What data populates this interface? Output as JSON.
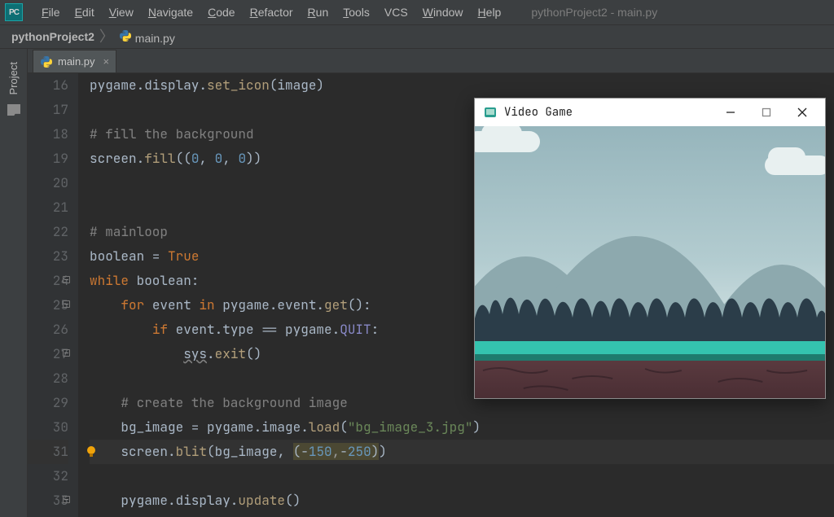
{
  "menubar": {
    "items": [
      "File",
      "Edit",
      "View",
      "Navigate",
      "Code",
      "Refactor",
      "Run",
      "Tools",
      "VCS",
      "Window",
      "Help"
    ],
    "window_title": "pythonProject2 - main.py"
  },
  "breadcrumb": {
    "project": "pythonProject2",
    "file": "main.py"
  },
  "sidebar": {
    "project_label": "Project"
  },
  "editor_tab": {
    "file": "main.py"
  },
  "gutter": {
    "start": 16,
    "count": 18,
    "bulb_line": 31
  },
  "code_lines": [
    {
      "n": 16,
      "segs": [
        {
          "t": "pygame.display."
        },
        {
          "t": "set_icon",
          "c": "tok-func"
        },
        {
          "t": "(image)"
        }
      ]
    },
    {
      "n": 17,
      "segs": []
    },
    {
      "n": 18,
      "segs": [
        {
          "t": "# fill the background",
          "c": "tok-comm"
        }
      ]
    },
    {
      "n": 19,
      "segs": [
        {
          "t": "screen."
        },
        {
          "t": "fill",
          "c": "tok-func"
        },
        {
          "t": "(("
        },
        {
          "t": "0",
          "c": "tok-num"
        },
        {
          "t": ", "
        },
        {
          "t": "0",
          "c": "tok-num"
        },
        {
          "t": ", "
        },
        {
          "t": "0",
          "c": "tok-num"
        },
        {
          "t": "))"
        }
      ]
    },
    {
      "n": 20,
      "segs": []
    },
    {
      "n": 21,
      "segs": []
    },
    {
      "n": 22,
      "segs": [
        {
          "t": "# mainloop",
          "c": "tok-comm"
        }
      ]
    },
    {
      "n": 23,
      "segs": [
        {
          "t": "boolean = "
        },
        {
          "t": "True",
          "c": "tok-key"
        }
      ]
    },
    {
      "n": 24,
      "segs": [
        {
          "t": "while ",
          "c": "tok-key"
        },
        {
          "t": "boolean:"
        }
      ],
      "fold": "minus"
    },
    {
      "n": 25,
      "segs": [
        {
          "t": "    "
        },
        {
          "t": "for ",
          "c": "tok-key"
        },
        {
          "t": "event "
        },
        {
          "t": "in ",
          "c": "tok-key"
        },
        {
          "t": "pygame.event."
        },
        {
          "t": "get",
          "c": "tok-func"
        },
        {
          "t": "():"
        }
      ],
      "fold": "minus"
    },
    {
      "n": 26,
      "segs": [
        {
          "t": "        "
        },
        {
          "t": "if ",
          "c": "tok-key"
        },
        {
          "t": "event.type == pygame."
        },
        {
          "t": "QUIT",
          "c": "tok-builtin"
        },
        {
          "t": ":"
        }
      ]
    },
    {
      "n": 27,
      "segs": [
        {
          "t": "            "
        },
        {
          "t": "sys",
          "c": "tok-wavy"
        },
        {
          "t": "."
        },
        {
          "t": "exit",
          "c": "tok-func"
        },
        {
          "t": "()"
        }
      ],
      "fold": "minus"
    },
    {
      "n": 28,
      "segs": []
    },
    {
      "n": 29,
      "segs": [
        {
          "t": "    "
        },
        {
          "t": "# create the background image",
          "c": "tok-comm"
        }
      ]
    },
    {
      "n": 30,
      "segs": [
        {
          "t": "    bg_image = pygame.image."
        },
        {
          "t": "load",
          "c": "tok-func"
        },
        {
          "t": "("
        },
        {
          "t": "\"bg_image_3.jpg\"",
          "c": "tok-str"
        },
        {
          "t": ")"
        }
      ]
    },
    {
      "n": 31,
      "hl": true,
      "segs": [
        {
          "t": "    screen."
        },
        {
          "t": "blit",
          "c": "tok-func"
        },
        {
          "t": "(bg_image"
        },
        {
          "t": ", ",
          "c": "tok-care"
        },
        {
          "t": "(",
          "c": "tok-warn"
        },
        {
          "t": "-",
          "c": "tok-warn"
        },
        {
          "t": "150",
          "c": "tok-num tok-warn"
        },
        {
          "t": ",",
          "c": "tok-warn caret-pos"
        },
        {
          "t": "-",
          "c": "tok-warn"
        },
        {
          "t": "250",
          "c": "tok-num tok-warn"
        },
        {
          "t": ")",
          "c": "tok-warn"
        },
        {
          "t": ")"
        }
      ]
    },
    {
      "n": 32,
      "segs": []
    },
    {
      "n": 33,
      "segs": [
        {
          "t": "    pygame.display."
        },
        {
          "t": "update",
          "c": "tok-func"
        },
        {
          "t": "()"
        }
      ],
      "fold": "minus"
    }
  ],
  "popup": {
    "title": "Video Game"
  }
}
